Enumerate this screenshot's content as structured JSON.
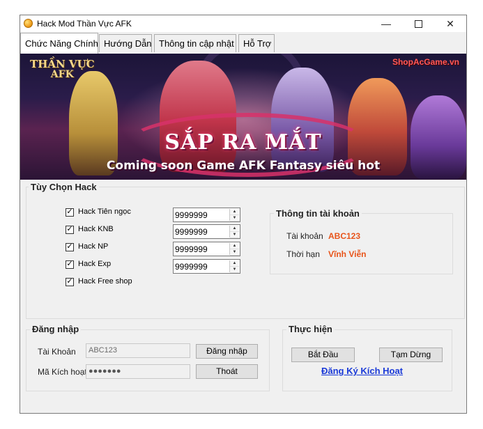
{
  "window": {
    "title": "Hack Mod Thần Vực AFK",
    "controls": {
      "minimize": "—",
      "close": "✕"
    }
  },
  "tabs": [
    {
      "label": "Chức Năng Chính"
    },
    {
      "label": "Hướng Dẫn"
    },
    {
      "label": "Thông tin cập nhật"
    },
    {
      "label": "Hỗ Trợ"
    }
  ],
  "banner": {
    "logo_line1": "THẦN VỰC",
    "logo_line2": "AFK",
    "shop": "ShopAcGame.vn",
    "headline": "SẮP RA MẮT",
    "subline": "Coming soon Game AFK Fantasy siêu hot"
  },
  "hack_options": {
    "title": "Tùy Chọn Hack",
    "items": [
      {
        "label": "Hack Tiên ngọc",
        "checked": true,
        "value": "9999999"
      },
      {
        "label": "Hack KNB",
        "checked": true,
        "value": "9999999"
      },
      {
        "label": "Hack NP",
        "checked": true,
        "value": "9999999"
      },
      {
        "label": "Hack Exp",
        "checked": true,
        "value": "9999999"
      },
      {
        "label": "Hack Free shop",
        "checked": true
      }
    ]
  },
  "account_info": {
    "title": "Thông tin tài khoản",
    "account_label": "Tài khoản",
    "account_value": "ABC123",
    "term_label": "Thời hạn",
    "term_value": "Vĩnh Viễn"
  },
  "login": {
    "title": "Đăng nhập",
    "account_label": "Tài Khoản",
    "account_value": "ABC123",
    "code_label": "Mã Kích hoạt",
    "code_value": "●●●●●●●",
    "login_button": "Đăng nhập",
    "exit_button": "Thoát"
  },
  "execute": {
    "title": "Thực hiện",
    "start_button": "Bắt Đầu",
    "pause_button": "Tạm Dừng",
    "register_link": "Đăng Ký Kích Hoạt"
  },
  "colors": {
    "accent_value": "#e8541a",
    "link": "#1a3ad8"
  }
}
